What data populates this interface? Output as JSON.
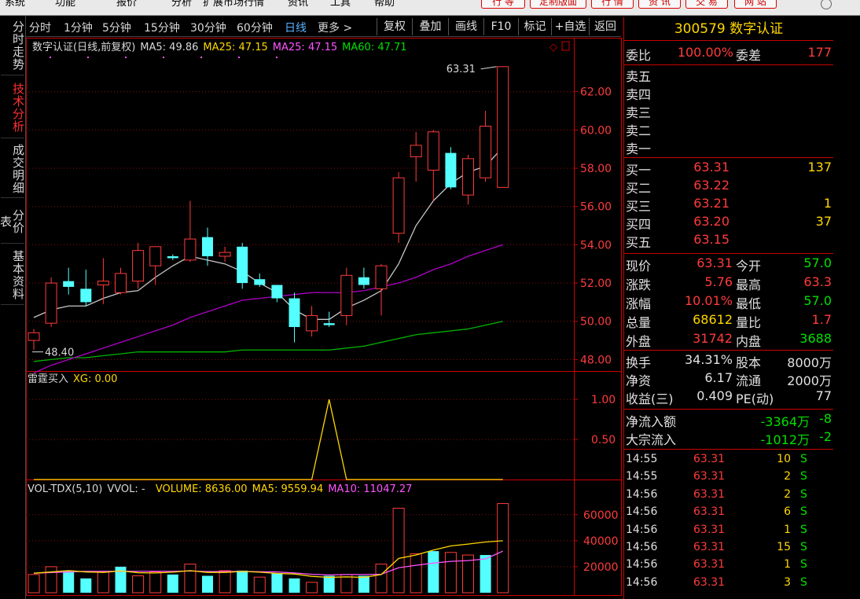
{
  "menubar": {
    "items": [
      "系统",
      "功能",
      "报价",
      "分析",
      "扩展市场行情",
      "资讯",
      "工具",
      "帮助"
    ],
    "right_buttons": [
      "行 等",
      "定制版面",
      "行 情",
      "资 讯",
      "交 易",
      "网 站"
    ]
  },
  "sidebar": {
    "tabs": [
      {
        "label": "分时走势",
        "active": false
      },
      {
        "label": "技术分析",
        "active": true
      },
      {
        "label": "成交明细",
        "active": false
      },
      {
        "label": "分价表",
        "active": false
      },
      {
        "label": "基本资料",
        "active": false
      }
    ]
  },
  "toolbar": {
    "periods": [
      "分时",
      "1分钟",
      "5分钟",
      "15分钟",
      "30分钟",
      "60分钟",
      "日线",
      "更多 >"
    ],
    "active_period": "日线",
    "buttons": [
      "复权",
      "叠加",
      "画线",
      "F10",
      "标记",
      "+自选",
      "返回"
    ]
  },
  "main_chart": {
    "header": {
      "name": "数字认证(日线,前复权)",
      "ma5": "MA5: 49.86",
      "ma25a": "MA25: 47.15",
      "ma25b": "MA25: 47.15",
      "ma60": "MA60: 47.71"
    },
    "ylim": [
      47.4,
      64.0
    ],
    "yticks": [
      "62.00",
      "60.00",
      "58.00",
      "56.00",
      "54.00",
      "52.00",
      "50.00",
      "48.00"
    ],
    "max_label": "63.31",
    "min_label": "48.40",
    "colors": {
      "up": "#ff3b3b",
      "down": "#54ffff",
      "ma5": "#c8c8c8",
      "ma25": "#b000c8",
      "ma60": "#00b400"
    }
  },
  "chart_data": [
    {
      "type": "candlestick",
      "title": "数字认证(日线,前复权)",
      "ylim": [
        47.4,
        64.0
      ],
      "ohlc": [
        [
          49.0,
          49.6,
          48.5,
          49.4
        ],
        [
          49.9,
          52.3,
          49.7,
          52.0
        ],
        [
          52.1,
          52.8,
          51.4,
          51.8
        ],
        [
          51.7,
          52.7,
          50.8,
          51.0
        ],
        [
          51.9,
          53.3,
          50.9,
          52.1
        ],
        [
          51.5,
          52.8,
          51.4,
          52.5
        ],
        [
          52.1,
          54.1,
          51.7,
          53.7
        ],
        [
          52.9,
          53.9,
          51.9,
          53.9
        ],
        [
          53.4,
          53.5,
          53.2,
          53.3
        ],
        [
          53.2,
          56.3,
          53.1,
          54.3
        ],
        [
          54.4,
          54.9,
          52.9,
          53.4
        ],
        [
          53.4,
          53.9,
          53.1,
          53.6
        ],
        [
          53.9,
          54.1,
          51.7,
          52.0
        ],
        [
          52.2,
          52.5,
          51.8,
          51.9
        ],
        [
          51.9,
          51.9,
          51.0,
          51.2
        ],
        [
          51.2,
          51.5,
          48.9,
          49.7
        ],
        [
          49.5,
          50.8,
          49.2,
          50.3
        ],
        [
          49.9,
          50.5,
          49.7,
          49.8
        ],
        [
          50.3,
          52.8,
          49.8,
          52.4
        ],
        [
          52.3,
          52.8,
          51.7,
          51.9
        ],
        [
          51.7,
          53.0,
          50.3,
          52.9
        ],
        [
          54.6,
          57.8,
          54.1,
          57.5
        ],
        [
          58.6,
          59.9,
          57.3,
          59.2
        ],
        [
          57.9,
          60.0,
          56.3,
          59.9
        ],
        [
          58.8,
          59.1,
          56.9,
          57.0
        ],
        [
          56.6,
          58.7,
          56.1,
          58.5
        ],
        [
          57.5,
          61.0,
          57.3,
          60.2
        ],
        [
          57.0,
          63.31,
          57.0,
          63.31
        ]
      ],
      "ma5": [
        50.2,
        50.6,
        50.8,
        50.8,
        51.2,
        51.5,
        51.6,
        52.3,
        52.9,
        53.4,
        53.2,
        53.0,
        52.6,
        52.0,
        51.5,
        50.6,
        50.1,
        50.1,
        50.7,
        51.1,
        51.6,
        53.0,
        55.0,
        56.3,
        57.2,
        57.8,
        58.1,
        59.1
      ],
      "ma25": [
        47.3,
        47.7,
        48.0,
        48.3,
        48.6,
        48.9,
        49.2,
        49.5,
        49.8,
        50.2,
        50.5,
        50.8,
        51.1,
        51.2,
        51.3,
        51.4,
        51.5,
        51.5,
        51.5,
        51.6,
        51.8,
        52.0,
        52.3,
        52.7,
        53.0,
        53.4,
        53.7,
        54.0
      ],
      "ma60": [
        47.9,
        48.0,
        48.1,
        48.1,
        48.2,
        48.3,
        48.4,
        48.4,
        48.4,
        48.4,
        48.4,
        48.4,
        48.5,
        48.5,
        48.5,
        48.5,
        48.5,
        48.5,
        48.6,
        48.7,
        48.9,
        49.1,
        49.3,
        49.4,
        49.5,
        49.6,
        49.8,
        50.0
      ]
    },
    {
      "type": "line",
      "title": "雷霆买入",
      "series": [
        {
          "name": "XG",
          "values": [
            0,
            0,
            0,
            0,
            0,
            0,
            0,
            0,
            0,
            0,
            0,
            0,
            0,
            0,
            0,
            0,
            0,
            1,
            0,
            0,
            0,
            0,
            0,
            0,
            0,
            0,
            0,
            0
          ]
        }
      ],
      "ylim": [
        0,
        1.1
      ]
    },
    {
      "type": "bar",
      "title": "VOL-TDX(5,10)",
      "values": [
        14000,
        20000,
        17000,
        11000,
        16000,
        20000,
        13000,
        16000,
        14000,
        22000,
        13000,
        17000,
        17000,
        12000,
        15000,
        11000,
        8000,
        13000,
        14000,
        13000,
        22000,
        65000,
        30000,
        32000,
        31000,
        29000,
        29000,
        68612
      ],
      "up": [
        true,
        true,
        false,
        false,
        true,
        false,
        true,
        true,
        false,
        true,
        false,
        true,
        false,
        true,
        false,
        false,
        true,
        false,
        true,
        false,
        true,
        true,
        true,
        false,
        true,
        true,
        false,
        true
      ],
      "ma5": [
        15000,
        16000,
        17000,
        16000,
        15600,
        16800,
        15400,
        15200,
        15800,
        17000,
        15600,
        15600,
        16400,
        15800,
        14800,
        14400,
        12600,
        11800,
        12200,
        11800,
        14000,
        26400,
        29000,
        32800,
        36000,
        37400,
        39000,
        40000
      ],
      "ma10": [
        15000,
        15500,
        16000,
        16500,
        16500,
        16500,
        16500,
        16500,
        16500,
        16700,
        16300,
        16300,
        16400,
        16200,
        16000,
        15200,
        14200,
        13700,
        14000,
        14000,
        14200,
        19200,
        21100,
        22800,
        24100,
        24700,
        26000,
        32000
      ],
      "ylim": [
        0,
        75000
      ]
    }
  ],
  "indicator": {
    "header_name": "雷霆买入",
    "header_xg": "XG: 0.00",
    "yticks": [
      "1.00",
      "0.50"
    ]
  },
  "volume": {
    "header_name": "VOL-TDX(5,10)",
    "header_vvol": "VVOL: -",
    "header_volume": "VOLUME: 8636.00",
    "header_ma5": "MA5: 9559.94",
    "header_ma10": "MA10: 11047.27",
    "yticks": [
      "60000",
      "40000",
      "20000"
    ]
  },
  "quote": {
    "code_name": "300579 数字认证",
    "weibi_label": "委比",
    "weibi_value": "100.00%",
    "weicha_label": "委差",
    "weicha_value": "177",
    "sells": [
      {
        "label": "卖五"
      },
      {
        "label": "卖四"
      },
      {
        "label": "卖三"
      },
      {
        "label": "卖二"
      },
      {
        "label": "卖一"
      }
    ],
    "buys": [
      {
        "label": "买一",
        "price": "63.31",
        "vol": "137"
      },
      {
        "label": "买二",
        "price": "63.22",
        "vol": ""
      },
      {
        "label": "买三",
        "price": "63.21",
        "vol": "1"
      },
      {
        "label": "买四",
        "price": "63.20",
        "vol": "37"
      },
      {
        "label": "买五",
        "price": "63.15",
        "vol": ""
      }
    ],
    "stats": [
      {
        "l1": "现价",
        "v1": "63.31",
        "c1": "red",
        "l2": "今开",
        "v2": "57.0",
        "c2": "grn"
      },
      {
        "l1": "涨跌",
        "v1": "5.76",
        "c1": "red",
        "l2": "最高",
        "v2": "63.3",
        "c2": "red"
      },
      {
        "l1": "涨幅",
        "v1": "10.01%",
        "c1": "red",
        "l2": "最低",
        "v2": "57.0",
        "c2": "grn"
      },
      {
        "l1": "总量",
        "v1": "68612",
        "c1": "yel",
        "l2": "量比",
        "v2": "1.7",
        "c2": "red"
      },
      {
        "l1": "外盘",
        "v1": "31742",
        "c1": "red",
        "l2": "内盘",
        "v2": "3688",
        "c2": "grn"
      }
    ],
    "fund": [
      {
        "l1": "换手",
        "v1": "34.31%",
        "l2": "股本",
        "v2": "8000万"
      },
      {
        "l1": "净资",
        "v1": "6.17",
        "l2": "流通",
        "v2": "2000万"
      },
      {
        "l1": "收益(三)",
        "v1": "0.409",
        "l2": "PE(动)",
        "v2": "77"
      }
    ],
    "flow": [
      {
        "l": "净流入额",
        "v": "-3364万",
        "v2": "-8"
      },
      {
        "l": "大宗流入",
        "v": "-1012万",
        "v2": "-2"
      }
    ],
    "ticks": [
      {
        "t": "14:55",
        "p": "63.31",
        "v": "10",
        "s": "S"
      },
      {
        "t": "14:55",
        "p": "63.31",
        "v": "2",
        "s": "S"
      },
      {
        "t": "14:56",
        "p": "63.31",
        "v": "2",
        "s": "S"
      },
      {
        "t": "14:56",
        "p": "63.31",
        "v": "6",
        "s": "S"
      },
      {
        "t": "14:56",
        "p": "63.31",
        "v": "1",
        "s": "S"
      },
      {
        "t": "14:56",
        "p": "63.31",
        "v": "15",
        "s": "S"
      },
      {
        "t": "14:56",
        "p": "63.31",
        "v": "1",
        "s": "S"
      },
      {
        "t": "14:56",
        "p": "63.31",
        "v": "3",
        "s": "S"
      }
    ]
  }
}
